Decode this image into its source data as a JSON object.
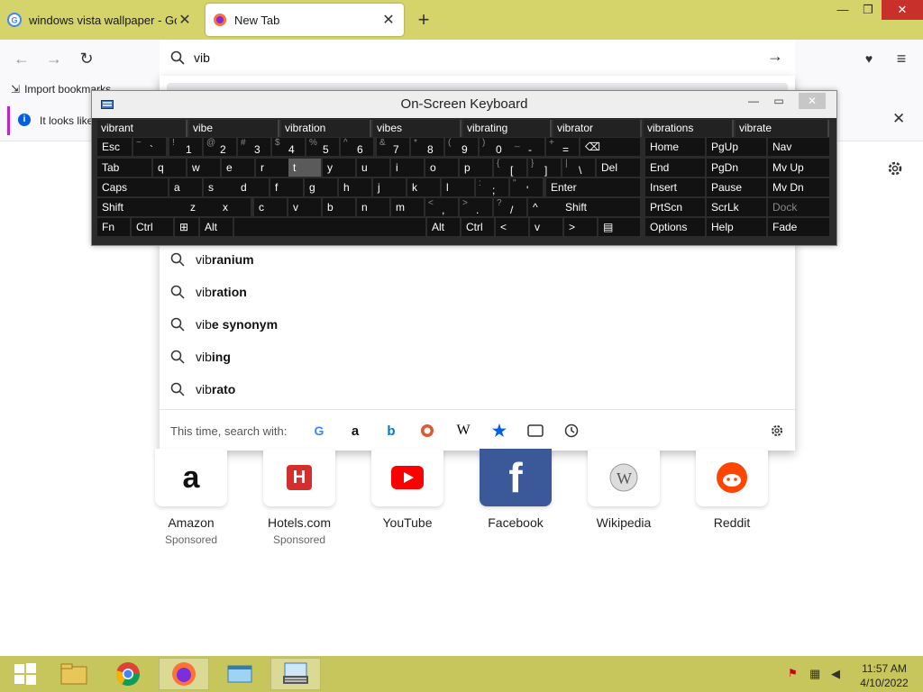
{
  "browser": {
    "tabs": [
      {
        "title": "windows vista wallpaper - Google",
        "close": "✕"
      },
      {
        "title": "New Tab",
        "close": "✕"
      }
    ],
    "new_tab": "+",
    "window_controls": {
      "minimize": "—",
      "maximize": "❐",
      "close": "✕"
    },
    "nav": {
      "back": "←",
      "forward": "→",
      "reload": "↻"
    },
    "url": {
      "value": "vib",
      "go": "→"
    },
    "toolbar_right": {
      "pocket": "♥",
      "menu": "≡"
    },
    "bookmarks": {
      "import": "Import bookmarks"
    },
    "infobar": {
      "icon": "i",
      "text": "It looks like",
      "close": "✕"
    }
  },
  "suggestions": [
    {
      "prefix": "vib",
      "rest": "ranium"
    },
    {
      "prefix": "vib",
      "rest": "ration"
    },
    {
      "prefix": "vib",
      "rest": "e synonym"
    },
    {
      "prefix": "vib",
      "rest": "ing"
    },
    {
      "prefix": "vib",
      "rest": "rato"
    }
  ],
  "search_with": {
    "label": "This time, search with:",
    "engines": [
      "google",
      "amazon",
      "bing",
      "duckduckgo",
      "wikipedia",
      "bookmarks",
      "tabs",
      "history"
    ],
    "wiki_glyph": "W"
  },
  "top_sites": [
    {
      "name": "Amazon",
      "sponsored": "Sponsored"
    },
    {
      "name": "Hotels.com",
      "sponsored": "Sponsored"
    },
    {
      "name": "YouTube",
      "sponsored": ""
    },
    {
      "name": "Facebook",
      "sponsored": ""
    },
    {
      "name": "Wikipedia",
      "sponsored": ""
    },
    {
      "name": "Reddit",
      "sponsored": ""
    }
  ],
  "osk": {
    "title": "On-Screen Keyboard",
    "buttons": {
      "minimize": "—",
      "maximize": "▭",
      "close": "✕"
    },
    "predictions": [
      "vibrant",
      "vibe",
      "vibration",
      "vibes",
      "vibrating",
      "vibrator",
      "vibrations",
      "vibrate"
    ],
    "rows": [
      [
        {
          "m": "Esc"
        },
        {
          "s": "~",
          "b": "`"
        },
        {
          "s": "!",
          "b": "1"
        },
        {
          "s": "@",
          "b": "2"
        },
        {
          "s": "#",
          "b": "3"
        },
        {
          "s": "$",
          "b": "4"
        },
        {
          "s": "%",
          "b": "5"
        },
        {
          "s": "^",
          "b": "6"
        },
        {
          "s": "&",
          "b": "7"
        },
        {
          "s": "*",
          "b": "8"
        },
        {
          "s": "(",
          "b": "9"
        },
        {
          "s": ")",
          "b": "0"
        },
        {
          "s": "_",
          "b": "-"
        },
        {
          "s": "+",
          "b": "="
        },
        {
          "m": "⌫"
        }
      ],
      [
        {
          "m": "Tab"
        },
        {
          "m": "q"
        },
        {
          "m": "w"
        },
        {
          "m": "e"
        },
        {
          "m": "r"
        },
        {
          "m": "t"
        },
        {
          "m": "y"
        },
        {
          "m": "u"
        },
        {
          "m": "i"
        },
        {
          "m": "o"
        },
        {
          "m": "p"
        },
        {
          "s": "{",
          "b": "["
        },
        {
          "s": "}",
          "b": "]"
        },
        {
          "s": "|",
          "b": "\\"
        },
        {
          "m": "Del"
        }
      ],
      [
        {
          "m": "Caps"
        },
        {
          "m": "a"
        },
        {
          "m": "s"
        },
        {
          "m": "d"
        },
        {
          "m": "f"
        },
        {
          "m": "g"
        },
        {
          "m": "h"
        },
        {
          "m": "j"
        },
        {
          "m": "k"
        },
        {
          "m": "l"
        },
        {
          "s": ":",
          "b": ";"
        },
        {
          "s": "\"",
          "b": "'"
        },
        {
          "m": "Enter"
        }
      ],
      [
        {
          "m": "Shift"
        },
        {
          "m": "z"
        },
        {
          "m": "x"
        },
        {
          "m": "c"
        },
        {
          "m": "v"
        },
        {
          "m": "b"
        },
        {
          "m": "n"
        },
        {
          "m": "m"
        },
        {
          "s": "<",
          "b": ","
        },
        {
          "s": ">",
          "b": "."
        },
        {
          "s": "?",
          "b": "/"
        },
        {
          "m": "^"
        },
        {
          "m": "Shift"
        }
      ],
      [
        {
          "m": "Fn"
        },
        {
          "m": "Ctrl"
        },
        {
          "m": "⊞"
        },
        {
          "m": "Alt"
        },
        {
          "m": ""
        },
        {
          "m": "Alt"
        },
        {
          "m": "Ctrl"
        },
        {
          "m": "<"
        },
        {
          "m": "v"
        },
        {
          "m": ">"
        },
        {
          "m": "▤"
        }
      ]
    ],
    "nav_rows": [
      [
        {
          "m": "Home"
        },
        {
          "m": "PgUp"
        },
        {
          "m": "Nav"
        }
      ],
      [
        {
          "m": "End"
        },
        {
          "m": "PgDn"
        },
        {
          "m": "Mv Up"
        }
      ],
      [
        {
          "m": "Insert"
        },
        {
          "m": "Pause"
        },
        {
          "m": "Mv Dn"
        }
      ],
      [
        {
          "m": "PrtScn"
        },
        {
          "m": "ScrLk"
        },
        {
          "m": "Dock"
        }
      ],
      [
        {
          "m": "Options"
        },
        {
          "m": "Help"
        },
        {
          "m": "Fade"
        }
      ]
    ]
  },
  "taskbar": {
    "items": [
      "start",
      "file-explorer",
      "chrome",
      "firefox",
      "app-window",
      "on-screen-keyboard"
    ],
    "clock": {
      "time": "11:57 AM",
      "date": "4/10/2022"
    }
  }
}
